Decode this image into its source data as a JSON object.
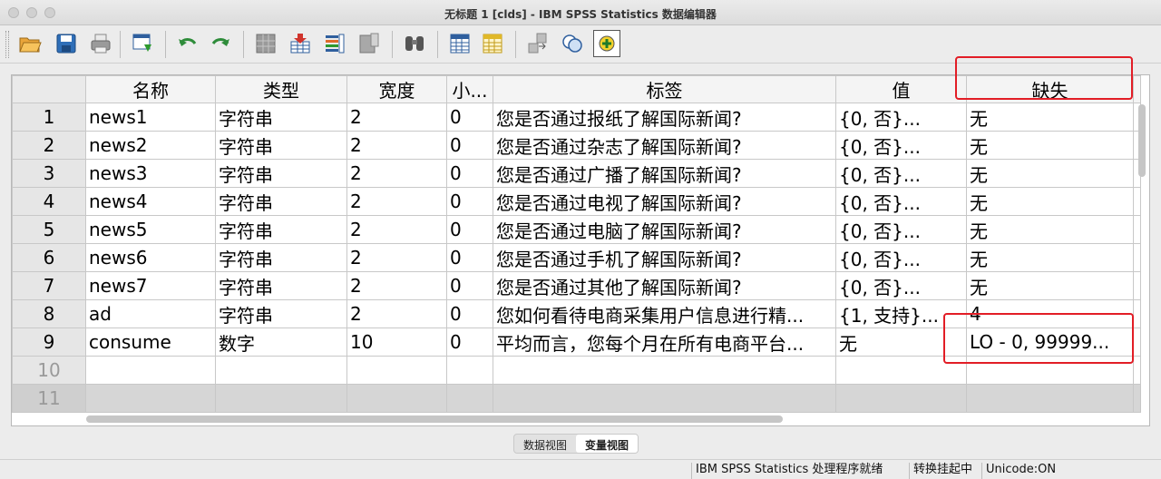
{
  "window": {
    "title": "无标题 1 [clds] - IBM SPSS Statistics 数据编辑器"
  },
  "toolbar": {
    "buttons": [
      "open-icon",
      "save-icon",
      "print-icon",
      "recall-dialog-icon",
      "undo-icon",
      "redo-icon",
      "goto-case-icon",
      "goto-variable-icon",
      "variables-icon",
      "run-descriptives-icon",
      "find-icon",
      "insert-cases-icon",
      "insert-variable-icon",
      "split-file-icon",
      "value-labels-icon",
      "use-sets-icon",
      "spelling-icon"
    ]
  },
  "grid": {
    "columns": [
      "名称",
      "类型",
      "宽度",
      "小...",
      "标签",
      "值",
      "缺失"
    ],
    "rows": [
      {
        "num": "1",
        "name": "news1",
        "type": "字符串",
        "width": "2",
        "decimals": "0",
        "label": "您是否通过报纸了解国际新闻?",
        "values": "{0, 否}...",
        "missing": "无"
      },
      {
        "num": "2",
        "name": "news2",
        "type": "字符串",
        "width": "2",
        "decimals": "0",
        "label": "您是否通过杂志了解国际新闻?",
        "values": "{0, 否}...",
        "missing": "无"
      },
      {
        "num": "3",
        "name": "news3",
        "type": "字符串",
        "width": "2",
        "decimals": "0",
        "label": "您是否通过广播了解国际新闻?",
        "values": "{0, 否}...",
        "missing": "无"
      },
      {
        "num": "4",
        "name": "news4",
        "type": "字符串",
        "width": "2",
        "decimals": "0",
        "label": "您是否通过电视了解国际新闻?",
        "values": "{0, 否}...",
        "missing": "无"
      },
      {
        "num": "5",
        "name": "news5",
        "type": "字符串",
        "width": "2",
        "decimals": "0",
        "label": "您是否通过电脑了解国际新闻?",
        "values": "{0, 否}...",
        "missing": "无"
      },
      {
        "num": "6",
        "name": "news6",
        "type": "字符串",
        "width": "2",
        "decimals": "0",
        "label": "您是否通过手机了解国际新闻?",
        "values": "{0, 否}...",
        "missing": "无"
      },
      {
        "num": "7",
        "name": "news7",
        "type": "字符串",
        "width": "2",
        "decimals": "0",
        "label": "您是否通过其他了解国际新闻?",
        "values": "{0, 否}...",
        "missing": "无"
      },
      {
        "num": "8",
        "name": "ad",
        "type": "字符串",
        "width": "2",
        "decimals": "0",
        "label": "您如何看待电商采集用户信息进行精...",
        "values": "{1, 支持}...",
        "missing": "4"
      },
      {
        "num": "9",
        "name": "consume",
        "type": "数字",
        "width": "10",
        "decimals": "0",
        "label": "平均而言，您每个月在所有电商平台...",
        "values": "无",
        "missing": "LO - 0, 99999..."
      }
    ],
    "empty_rows": [
      "10",
      "11"
    ]
  },
  "view_tabs": {
    "data_view": "数据视图",
    "variable_view": "变量视图"
  },
  "status": {
    "processor": "IBM SPSS Statistics 处理程序就绪",
    "transform": "转换挂起中",
    "unicode": "Unicode:ON"
  },
  "colors": {
    "highlight": "#e21d26"
  }
}
